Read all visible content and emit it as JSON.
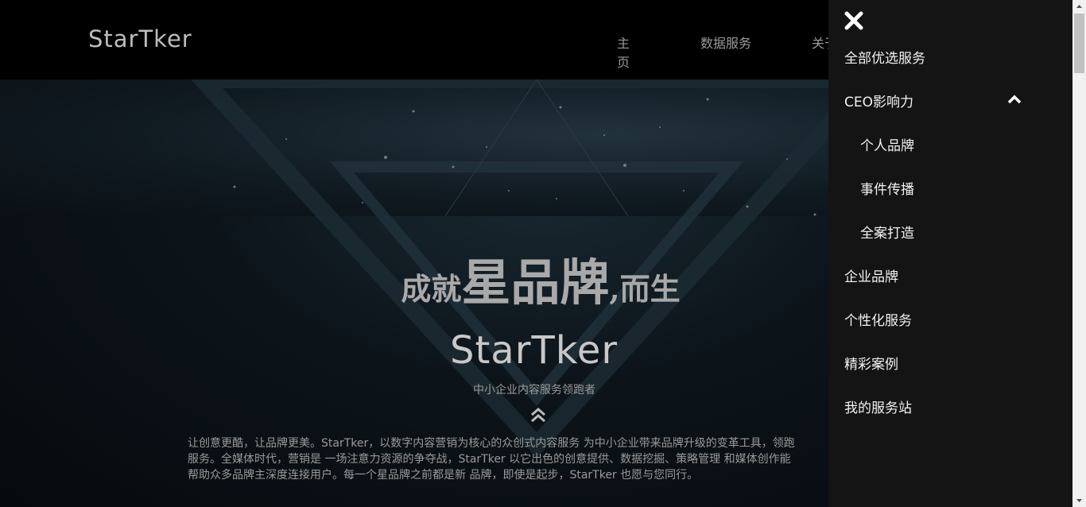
{
  "header": {
    "logo": "StarTker",
    "nav": [
      "主页",
      "数据服务",
      "关于"
    ]
  },
  "hero": {
    "tagline_small_1": "成就",
    "tagline_big": "星品牌",
    "tagline_small_2": ",而生",
    "brand": "StarTker",
    "subtitle": "中小企业内容服务领跑者",
    "description": [
      "让创意更酷，让品牌更美。StarTker，以数字内容营销为核心的众创式内容服务 为中小企业带来品牌升级的变革工具，领跑",
      "服务。全媒体时代，营销是 一场注意力资源的争夺战，StarTker 以它出色的创意提供、数据挖掘、策略管理 和媒体创作能",
      "帮助众多品牌主深度连接用户。每一个星品牌之前都是新 品牌，即使是起步，StarTker 也愿与您同行。"
    ]
  },
  "drawer": {
    "items": [
      {
        "label": "全部优选服务"
      },
      {
        "label": "CEO影响力"
      },
      {
        "label": "个人品牌"
      },
      {
        "label": "事件传播"
      },
      {
        "label": "全案打造"
      },
      {
        "label": "企业品牌"
      },
      {
        "label": "个性化服务"
      },
      {
        "label": "精彩案例"
      },
      {
        "label": "我的服务站"
      }
    ]
  },
  "icons": {
    "close": "close-icon",
    "chevron": "chevron-up-icon",
    "scroll_up": "double-chevron-up-icon"
  },
  "colors": {
    "background": "#000000",
    "drawer": "#141414",
    "text_muted": "#9a9a9a"
  }
}
